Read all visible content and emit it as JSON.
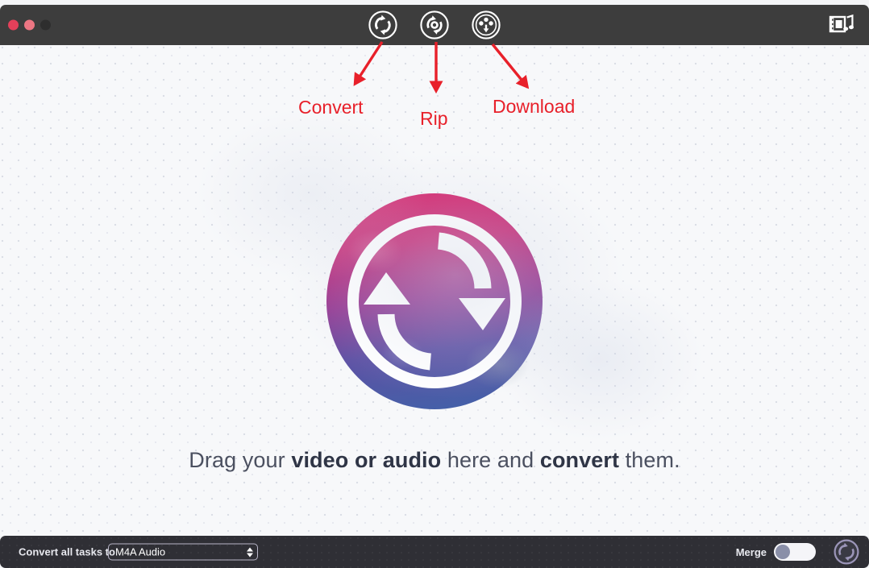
{
  "window": {
    "traffic_lights": [
      {
        "name": "close",
        "color": "#e3405a"
      },
      {
        "name": "minimize",
        "color": "#ec7683"
      },
      {
        "name": "zoom",
        "color": "#2e2e2e"
      }
    ]
  },
  "toolbar": {
    "background": "#3d3d3d",
    "buttons": [
      {
        "icon": "convert-icon",
        "label": "Convert"
      },
      {
        "icon": "rip-icon",
        "label": "Rip"
      },
      {
        "icon": "download-icon",
        "label": "Download"
      }
    ],
    "right_button": {
      "icon": "media-library-icon",
      "label": "Media Library"
    }
  },
  "annotations": {
    "color": "#e8202a",
    "labels": {
      "convert": "Convert",
      "rip": "Rip",
      "download": "Download"
    }
  },
  "main": {
    "logo": {
      "name": "convert-logo",
      "gradient_top": "#d42a6e",
      "gradient_bottom": "#4a5fa8"
    },
    "tagline": {
      "part1": "Drag your ",
      "bold1": "video or audio",
      "part2": " here and ",
      "bold2": "convert",
      "part3": " them."
    }
  },
  "bottom_bar": {
    "background": "#2f2f35",
    "convert_all_label": "Convert all tasks to",
    "format_select": {
      "value": "M4A Audio",
      "placeholder": "M4A Audio"
    },
    "merge": {
      "label": "Merge",
      "enabled": false
    },
    "run_button": {
      "icon": "convert-run-icon"
    }
  }
}
